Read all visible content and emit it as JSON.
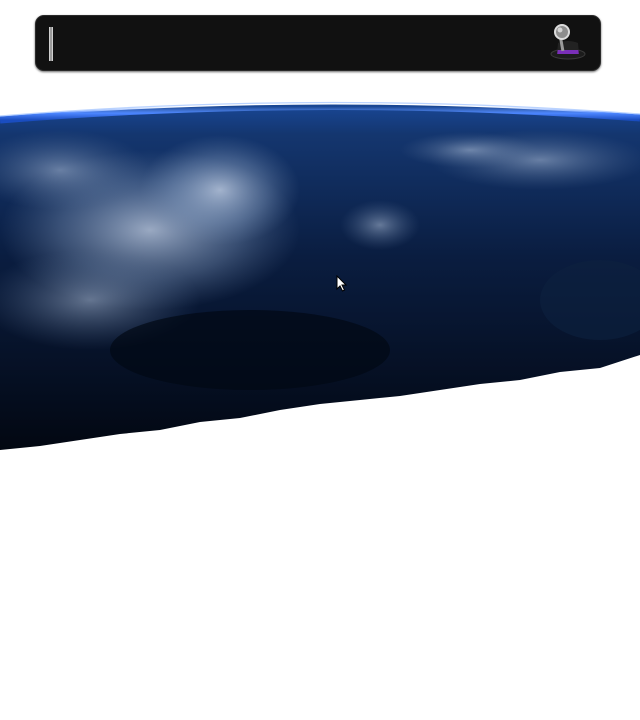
{
  "launcher": {
    "query": "",
    "placeholder": "",
    "icon": "alfred-hat-magnifier-icon"
  },
  "desktop": {
    "wallpaper": "earth-from-space-wallpaper",
    "cursor": "arrow-cursor-icon"
  },
  "colors": {
    "bar_background": "#111111",
    "atmosphere_glow": "#3f7bff",
    "hat_band": "#7a2fb8",
    "ocean_dark": "#07152e",
    "page_background": "#ffffff"
  }
}
